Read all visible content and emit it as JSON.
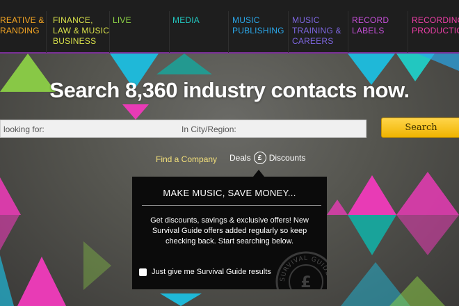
{
  "nav": {
    "items": [
      {
        "label": "REATIVE &\nRANDING",
        "color": "#f5a623"
      },
      {
        "label": "FINANCE,\nLAW & MUSIC\nBUSINESS",
        "color": "#d8e04a"
      },
      {
        "label": "LIVE",
        "color": "#8fd646"
      },
      {
        "label": "MEDIA",
        "color": "#22c7c0"
      },
      {
        "label": "MUSIC\nPUBLISHING",
        "color": "#2aa6e8"
      },
      {
        "label": "MUSIC\nTRAINING &\nCAREERS",
        "color": "#7d66e0"
      },
      {
        "label": "RECORD\nLABELS",
        "color": "#c64fd8"
      },
      {
        "label": "RECORDING\nPRODUCTION",
        "color": "#ee3fa8"
      }
    ]
  },
  "headline": "Search 8,360 industry contacts now.",
  "search": {
    "looking_for_label": "looking for:",
    "city_label": "In City/Region:",
    "button_label": "Search"
  },
  "tabs": {
    "find_company": "Find a Company",
    "deals": "Deals",
    "discounts": "Discounts",
    "pound_symbol": "£"
  },
  "popup": {
    "title": "MAKE MUSIC, SAVE MONEY...",
    "body": "Get discounts, savings & exclusive offers! New Survival Guide offers added regularly so keep checking back. Start searching below.",
    "checkbox_label": "Just give me Survival Guide results",
    "badge_text": "SURVIVAL GUIDE",
    "badge_symbol": "£"
  },
  "colors": {
    "pink": "#e83bb5",
    "cyan": "#1fb8d8",
    "teal": "#19a39a",
    "green": "#8fd646",
    "button": "#f5c518"
  }
}
